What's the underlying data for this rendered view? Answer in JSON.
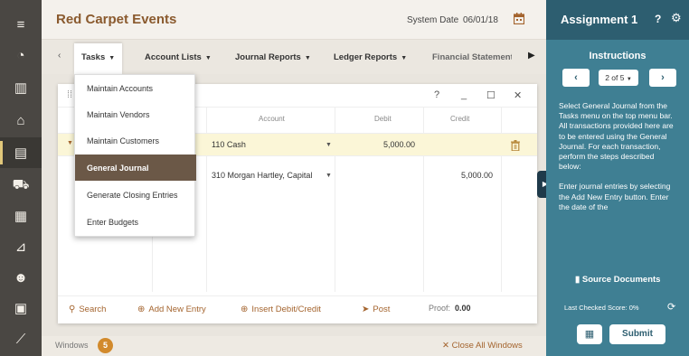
{
  "app": {
    "title": "Red Carpet Events",
    "system_date_label": "System Date",
    "system_date": "06/01/18"
  },
  "rail": {
    "items": [
      {
        "name": "hamburger-menu-icon",
        "glyph": "≡"
      },
      {
        "name": "dashboard-icon",
        "glyph": "◔"
      },
      {
        "name": "buildings-icon",
        "glyph": "▥"
      },
      {
        "name": "bank-icon",
        "glyph": "⌂"
      },
      {
        "name": "ledger-book-icon",
        "glyph": "▤"
      },
      {
        "name": "cart-icon",
        "glyph": "⛟"
      },
      {
        "name": "inventory-icon",
        "glyph": "▦"
      },
      {
        "name": "dolly-icon",
        "glyph": "⊿"
      },
      {
        "name": "people-icon",
        "glyph": "☻"
      },
      {
        "name": "calculator-icon",
        "glyph": "▣"
      },
      {
        "name": "chart-icon",
        "glyph": "⟋"
      }
    ]
  },
  "menubar": {
    "items": [
      "Tasks",
      "Account Lists",
      "Journal Reports",
      "Ledger Reports",
      "Financial Statements"
    ]
  },
  "tasks_menu": {
    "items": [
      "Maintain Accounts",
      "Maintain Vendors",
      "Maintain Customers",
      "General Journal",
      "Generate Closing Entries",
      "Enter Budgets"
    ],
    "selected": "General Journal"
  },
  "journal": {
    "columns": {
      "account": "Account",
      "debit": "Debit",
      "credit": "Credit"
    },
    "rows": [
      {
        "account": "110 Cash",
        "debit": "5,000.00",
        "credit": ""
      },
      {
        "account": "310 Morgan Hartley, Capital",
        "debit": "",
        "credit": "5,000.00"
      }
    ],
    "footer": {
      "search": "Search",
      "add_new_entry": "Add New Entry",
      "insert_debit_credit": "Insert Debit/Credit",
      "post": "Post",
      "proof_label": "Proof:",
      "proof_value": "0.00"
    }
  },
  "bottombar": {
    "windows_label": "Windows",
    "windows_count": "5",
    "close_all": "Close All Windows"
  },
  "assignment": {
    "title": "Assignment 1",
    "instructions_title": "Instructions",
    "pager": "2 of 5",
    "paragraphs": [
      "Select General Journal from the Tasks menu on the top menu bar. All transactions provided here are to be entered using the General Journal. For each transaction, perform the steps described below:",
      "Enter journal entries by selecting the Add New Entry button. Enter the date of the"
    ],
    "source_documents": "Source Documents",
    "score_label": "Last Checked Score: 0%",
    "submit": "Submit"
  },
  "colors": {
    "panel": "#3f7f93",
    "panel_header": "#2d5e70",
    "accent": "#a4642e",
    "selected_menu": "#6b5847",
    "row_highlight": "#fbf6d7"
  }
}
